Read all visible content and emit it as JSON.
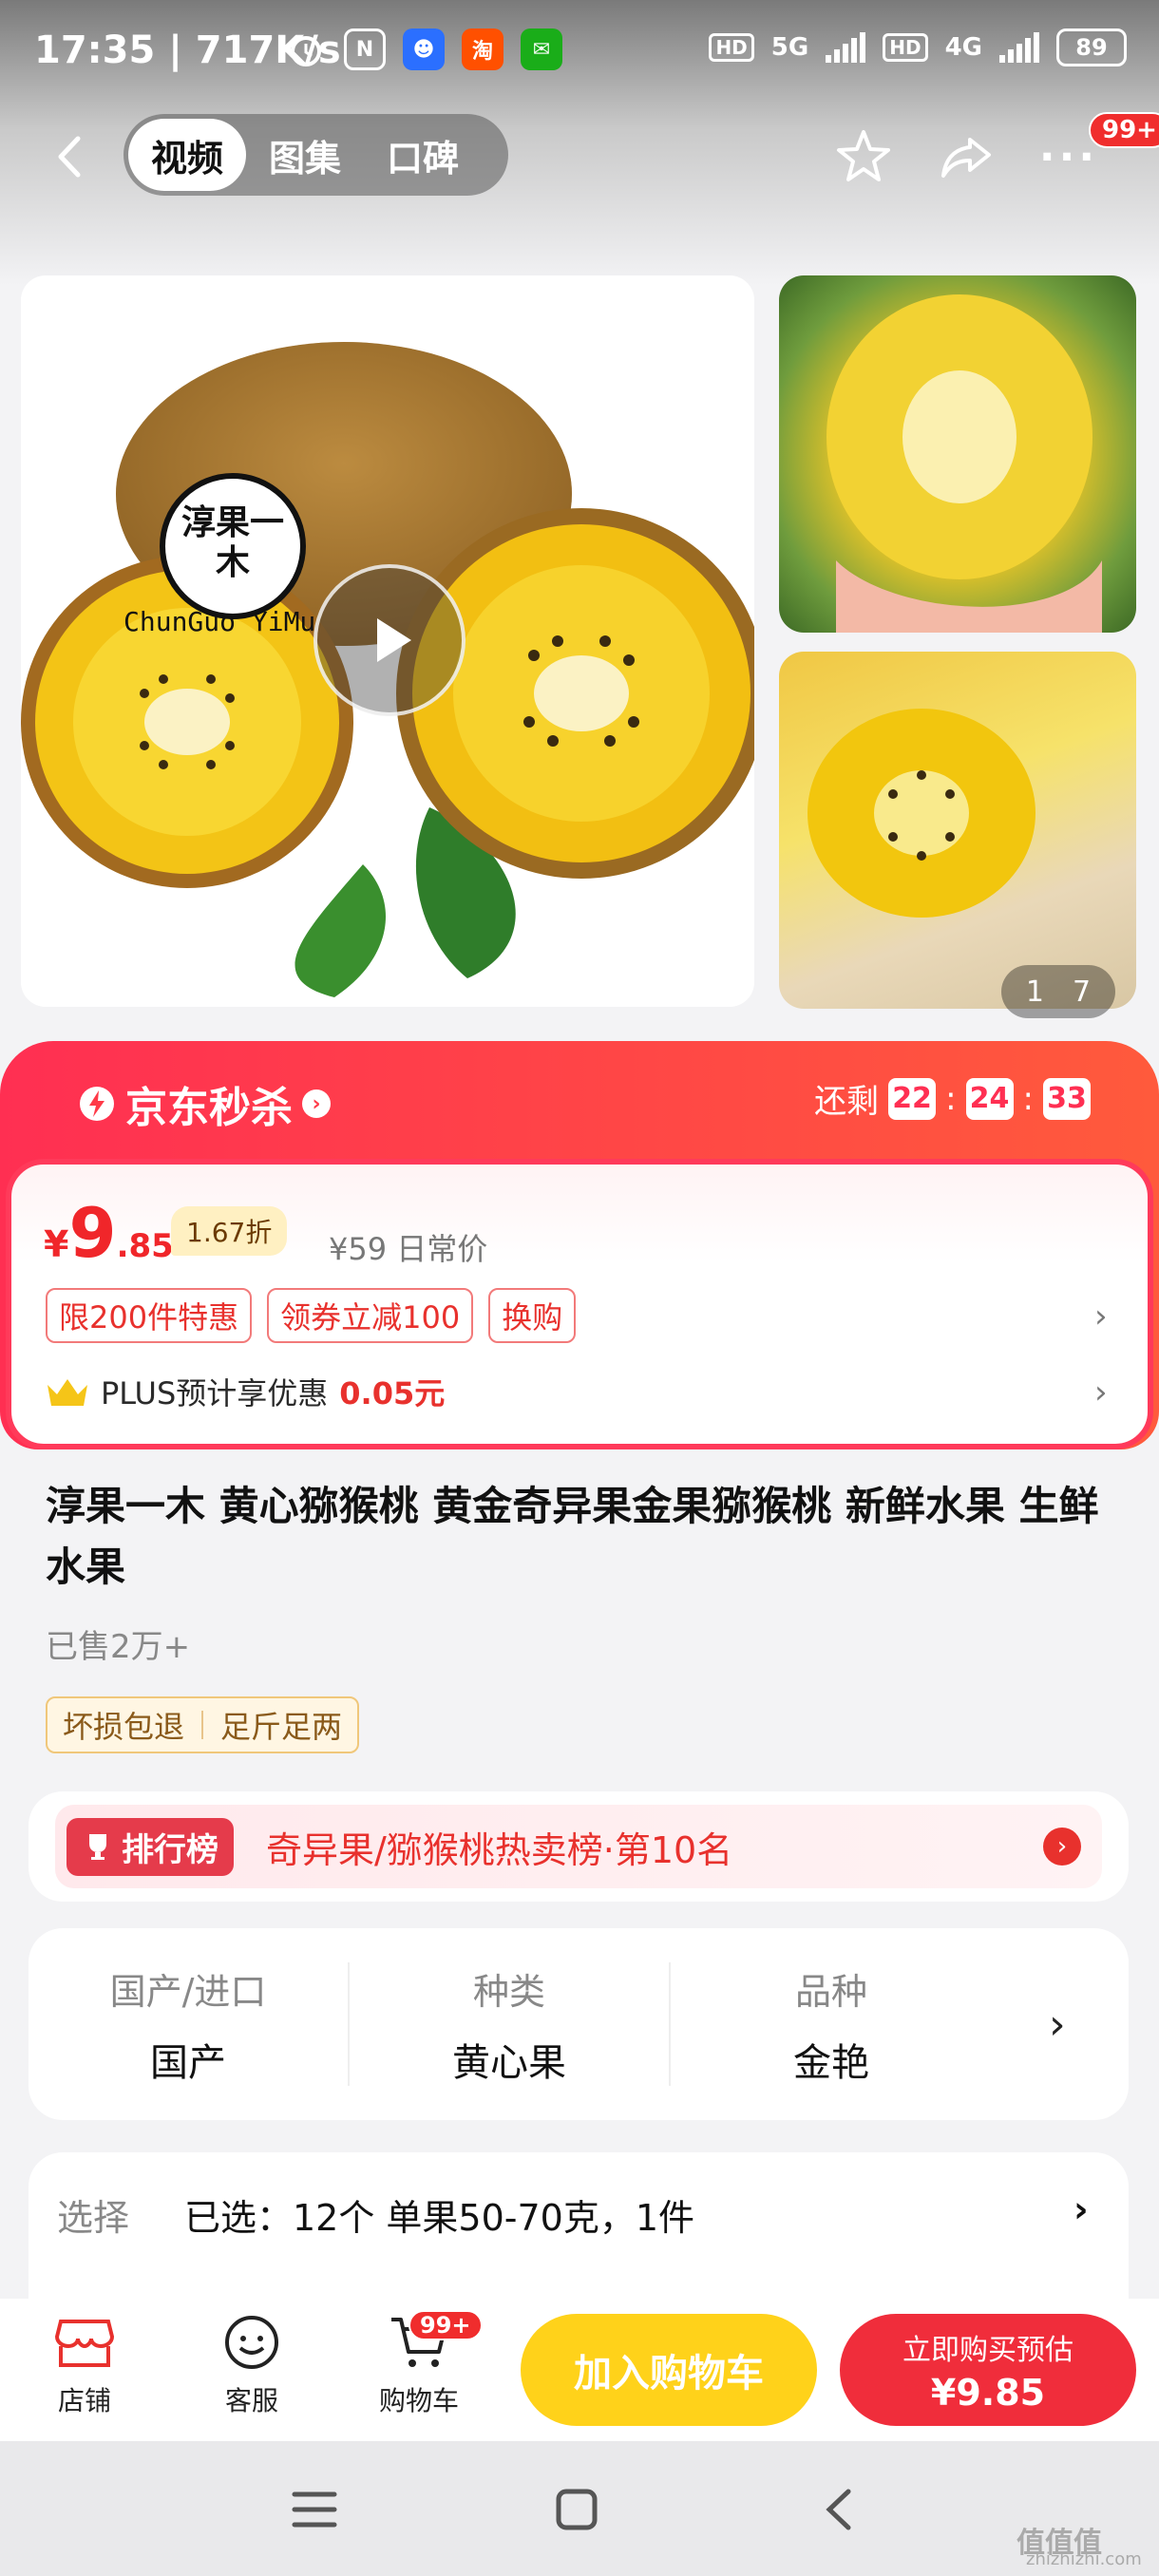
{
  "status_bar": {
    "time": "17:35",
    "speed": "717K/s",
    "network1": "5G",
    "network2": "4G",
    "hd": "HD",
    "battery": "89"
  },
  "nav": {
    "tabs": [
      {
        "label": "视频",
        "active": true
      },
      {
        "label": "图集",
        "active": false
      },
      {
        "label": "口碑",
        "active": false
      }
    ],
    "message_badge": "99+"
  },
  "gallery": {
    "brand_name": "淳果一木",
    "brand_pinyin": "ChunGuo YiMu",
    "page_current": "1",
    "page_total": "7"
  },
  "seckill": {
    "title": "京东秒杀",
    "remain_label": "还剩",
    "countdown": [
      "22",
      "24",
      "33"
    ],
    "price_symbol": "¥",
    "price_int": "9",
    "price_dec": ".85",
    "discount": "1.67折",
    "orig_price": "¥59",
    "orig_price_label": "日常价",
    "coupons": [
      "限200件特惠",
      "领券立减100",
      "换购"
    ],
    "plus_text": "PLUS预计享优惠",
    "plus_amount": "0.05元"
  },
  "product": {
    "title": "淳果一木 黄心猕猴桃 黄金奇异果金果猕猴桃 新鲜水果 生鲜 水果",
    "sold": "已售2万+",
    "service_tags": [
      "坏损包退",
      "足斤足两"
    ]
  },
  "ranking": {
    "badge": "排行榜",
    "text": "奇异果/猕猴桃热卖榜·第10名"
  },
  "specs": [
    {
      "label": "国产/进口",
      "value": "国产"
    },
    {
      "label": "种类",
      "value": "黄心果"
    },
    {
      "label": "品种",
      "value": "金艳"
    }
  ],
  "select": {
    "label": "选择",
    "value": "已选：12个 单果50-70克，1件"
  },
  "bottom_bar": {
    "store": "店铺",
    "service": "客服",
    "cart": "购物车",
    "cart_badge": "99+",
    "add_to_cart": "加入购物车",
    "buy_line1": "立即购买预估",
    "buy_line2": "¥9.85"
  },
  "watermark": {
    "text": "值值值",
    "site": "zhizhizhi.com"
  },
  "colors": {
    "accent_red": "#f02d3b",
    "yellow_button": "#ffd21a",
    "price_red": "#f0262a"
  }
}
